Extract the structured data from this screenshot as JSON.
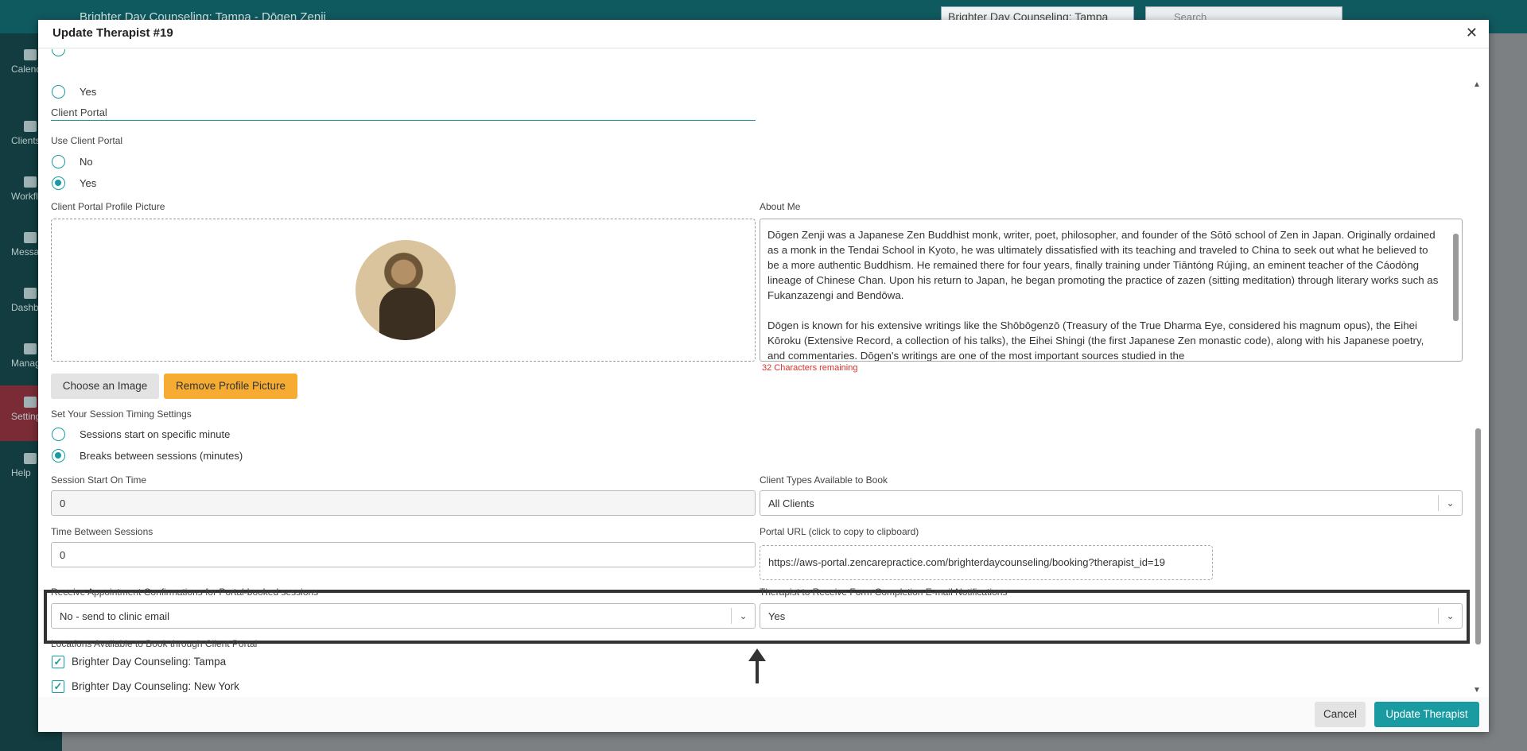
{
  "background_app": {
    "title": "Brighter Day Counseling: Tampa - Dōgen Zenji",
    "location_select": "Brighter Day Counseling: Tampa",
    "search_placeholder": "Search",
    "sidebar": [
      "Calendar",
      "Clients",
      "Workflows",
      "Messages",
      "Dashboard",
      "Manage",
      "Settings",
      "Help"
    ]
  },
  "modal": {
    "title": "Update Therapist #19",
    "top_radio_yes": "Yes",
    "client_portal_heading": "Client Portal",
    "use_client_portal": {
      "label": "Use Client Portal",
      "options": [
        "No",
        "Yes"
      ],
      "selected": "Yes"
    },
    "profile_picture_label": "Client Portal Profile Picture",
    "about_me": {
      "label": "About Me",
      "paragraph1": "Dōgen Zenji was a Japanese Zen Buddhist monk, writer, poet, philosopher, and founder of the Sōtō school of Zen in Japan. Originally ordained as a monk in the Tendai School in Kyoto, he was ultimately dissatisfied with its teaching and traveled to China to seek out what he believed to be a more authentic Buddhism. He remained there for four years, finally training under Tiāntóng Rújìng, an eminent teacher of the Cáodòng lineage of Chinese Chan. Upon his return to Japan, he began promoting the practice of zazen (sitting meditation) through literary works such as Fukanzazengi and Bendōwa.",
      "paragraph2": "Dōgen is known for his extensive writings like the Shōbōgenzō (Treasury of the True Dharma Eye, considered his magnum opus), the Eihei Kōroku (Extensive Record, a collection of his talks), the Eihei Shingi (the first Japanese Zen monastic code), along with his Japanese poetry, and commentaries. Dōgen's writings are one of the most important sources studied in the",
      "chars_remaining": "32 Characters remaining"
    },
    "choose_image_button": "Choose an Image",
    "remove_picture_button": "Remove Profile Picture",
    "session_timing": {
      "label": "Set Your Session Timing Settings",
      "options": [
        "Sessions start on specific minute",
        "Breaks between sessions (minutes)"
      ],
      "selected": "Breaks between sessions (minutes)"
    },
    "session_start_on_time": {
      "label": "Session Start On Time",
      "value": "0"
    },
    "client_types": {
      "label": "Client Types Available to Book",
      "value": "All Clients"
    },
    "time_between_sessions": {
      "label": "Time Between Sessions",
      "value": "0"
    },
    "portal_url": {
      "label": "Portal URL (click to copy to clipboard)",
      "value": "https://aws-portal.zencarepractice.com/brighterdaycounseling/booking?therapist_id=19"
    },
    "receive_confirmations": {
      "label": "Receive Appointment Confirmations for Portal-booked sessions",
      "value": "No - send to clinic email"
    },
    "form_completion_notifications": {
      "label": "Therapist to Receive Form Completion E-mail Notifications",
      "value": "Yes"
    },
    "locations": {
      "label": "Locations Available to Book through Client Portal",
      "items": [
        "Brighter Day Counseling: Tampa",
        "Brighter Day Counseling: New York"
      ]
    },
    "cancel_button": "Cancel",
    "update_button": "Update Therapist",
    "accent_color": "#1a9ba1",
    "warning_color": "#f6ac32"
  }
}
